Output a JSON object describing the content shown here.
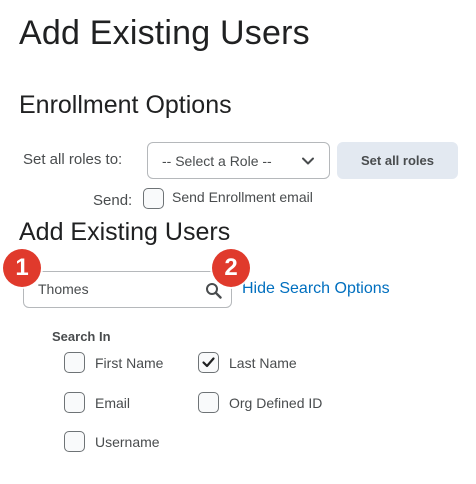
{
  "page": {
    "title": "Add Existing Users"
  },
  "enrollment": {
    "title": "Enrollment Options",
    "roles_label": "Set all roles to:",
    "role_select_value": "-- Select a Role --",
    "set_all_button": "Set all roles",
    "send_label": "Send:",
    "send_checkbox_label": "Send Enrollment email",
    "send_checked": false
  },
  "search": {
    "title": "Add Existing Users",
    "input_value": "Thomes",
    "hide_options_link": "Hide Search Options",
    "search_in_label": "Search In",
    "options": {
      "first_name": {
        "label": "First Name",
        "checked": false
      },
      "last_name": {
        "label": "Last Name",
        "checked": true
      },
      "email": {
        "label": "Email",
        "checked": false
      },
      "org_defined_id": {
        "label": "Org Defined ID",
        "checked": false
      },
      "username": {
        "label": "Username",
        "checked": false
      }
    }
  },
  "annotations": {
    "badge_1": "1",
    "badge_2": "2"
  },
  "colors": {
    "link": "#006fbf",
    "badge": "#e03a2c",
    "button_bg": "#e3e9f1"
  },
  "icons": {
    "search": "search-icon",
    "chevron": "chevron-down-icon",
    "check": "check-icon"
  }
}
